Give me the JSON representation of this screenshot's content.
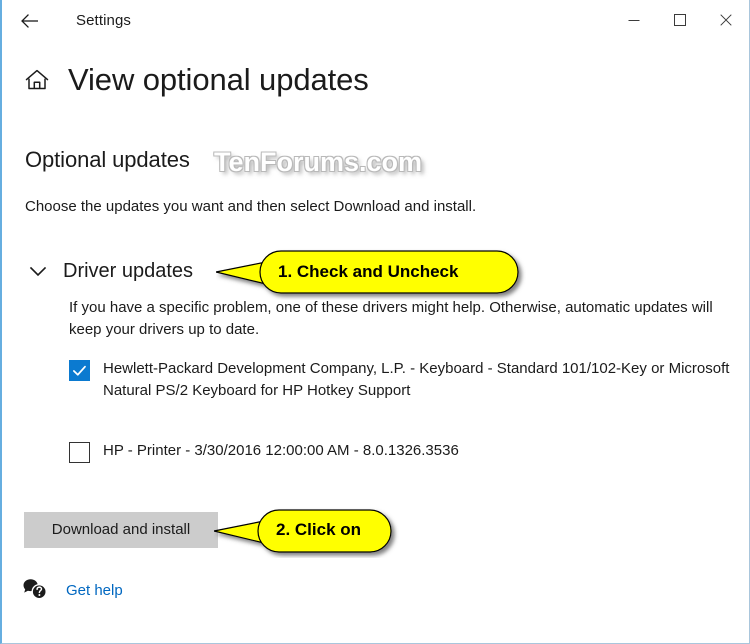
{
  "titlebar": {
    "back_icon": "back-arrow-icon",
    "title": "Settings",
    "minimize_label": "─",
    "maximize_label": "□",
    "close_label": "✕"
  },
  "header": {
    "home_icon": "home-icon",
    "page_title": "View optional updates"
  },
  "watermark": {
    "text": "TenForums.com"
  },
  "main": {
    "section_heading": "Optional updates",
    "intro_text": "Choose the updates you want and then select Download and install.",
    "group": {
      "chevron_icon": "chevron-down-icon",
      "title": "Driver updates",
      "description": "If you have a specific problem, one of these drivers might help. Otherwise, automatic updates will keep your drivers up to date."
    },
    "updates": [
      {
        "checked": true,
        "label": "Hewlett-Packard Development Company, L.P. - Keyboard - Standard 101/102-Key or Microsoft Natural PS/2 Keyboard for HP Hotkey Support"
      },
      {
        "checked": false,
        "label": "HP - Printer - 3/30/2016 12:00:00 AM - 8.0.1326.3536"
      }
    ],
    "download_button": "Download and install",
    "get_help": {
      "icon": "help-bubble-icon",
      "label": "Get help"
    }
  },
  "callouts": [
    {
      "text": "1. Check and Uncheck"
    },
    {
      "text": "2. Click on"
    }
  ],
  "colors": {
    "accent_blue": "#0b7ad0",
    "link_blue": "#0067c0",
    "callout_yellow": "#ffff00",
    "button_gray": "#cccccc",
    "window_border": "#66aee0"
  }
}
